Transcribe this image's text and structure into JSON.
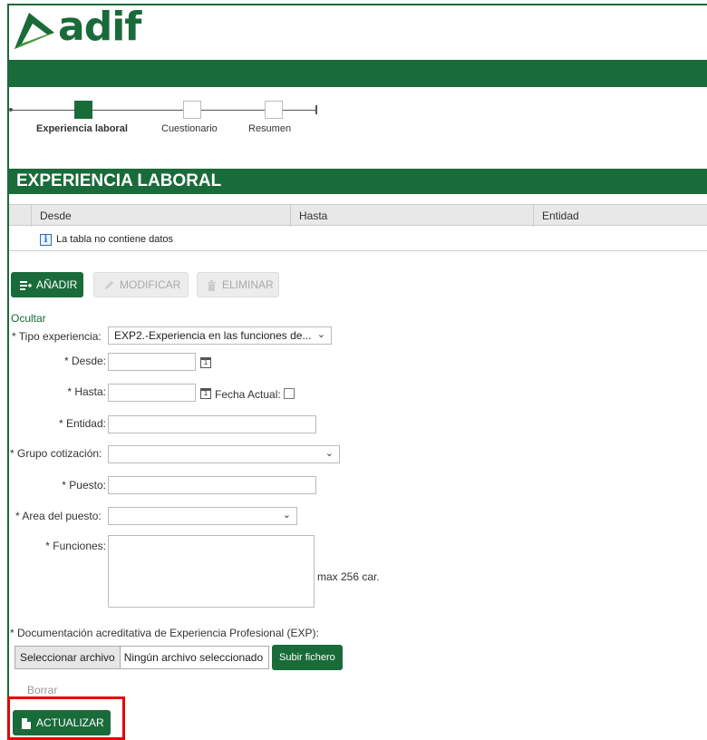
{
  "brand": {
    "name": "adif",
    "color": "#1a6b3a"
  },
  "stepper": {
    "steps": [
      {
        "label": "Experiencia laboral",
        "active": true
      },
      {
        "label": "Cuestionario",
        "active": false
      },
      {
        "label": "Resumen",
        "active": false
      }
    ]
  },
  "section": {
    "title": "EXPERIENCIA LABORAL"
  },
  "table": {
    "columns": [
      "Desde",
      "Hasta",
      "Entidad"
    ],
    "empty_message": "La tabla no contiene datos",
    "info_icon": "info-icon"
  },
  "toolbar": {
    "add_label": "AÑADIR",
    "modify_label": "MODIFICAR",
    "delete_label": "ELIMINAR"
  },
  "form": {
    "hide_link": "Ocultar",
    "tipo_experiencia": {
      "label": "* Tipo experiencia:",
      "value": "EXP2.-Experiencia en las funciones de..."
    },
    "desde": {
      "label": "* Desde:",
      "value": ""
    },
    "hasta": {
      "label": "* Hasta:",
      "value": "",
      "current_date_label": "Fecha Actual:",
      "current_date_checked": false
    },
    "entidad": {
      "label": "* Entidad:",
      "value": ""
    },
    "grupo_cotizacion": {
      "label": "* Grupo cotización:",
      "value": ""
    },
    "puesto": {
      "label": "* Puesto:",
      "value": ""
    },
    "area_puesto": {
      "label": "* Area del puesto:",
      "value": ""
    },
    "funciones": {
      "label": "* Funciones:",
      "value": "",
      "hint": "max 256 car."
    },
    "documentacion": {
      "label": "* Documentación acreditativa de Experiencia Profesional (EXP):",
      "select_file_label": "Seleccionar archivo",
      "no_file_label": "Ningún archivo seleccionado",
      "upload_label": "Subir fichero",
      "clear_label": "Borrar"
    },
    "update_label": "ACTUALIZAR"
  },
  "highlight_color": "#e60000"
}
